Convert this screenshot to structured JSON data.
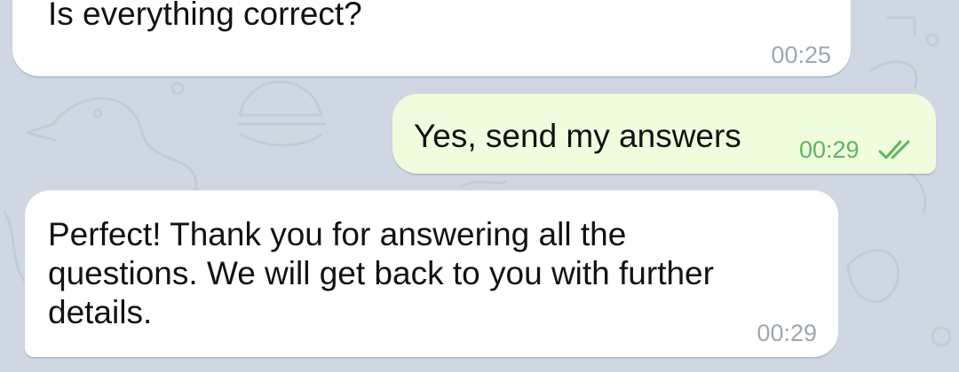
{
  "chat": {
    "messages": [
      {
        "direction": "incoming",
        "text": "Is everything correct?",
        "time": "00:25"
      },
      {
        "direction": "outgoing",
        "text": "Yes, send my answers",
        "time": "00:29",
        "status_icon": "double-check-icon"
      },
      {
        "direction": "incoming",
        "text": "Perfect! Thank you for answering all the\nquestions. We will get back to you with further\ndetails.",
        "time": "00:29"
      }
    ]
  },
  "colors": {
    "background": "#cfd8e2",
    "incoming_bubble": "#ffffff",
    "outgoing_bubble": "#effdde",
    "outgoing_time": "#5eb55b",
    "incoming_time": "#a0a7ad"
  }
}
